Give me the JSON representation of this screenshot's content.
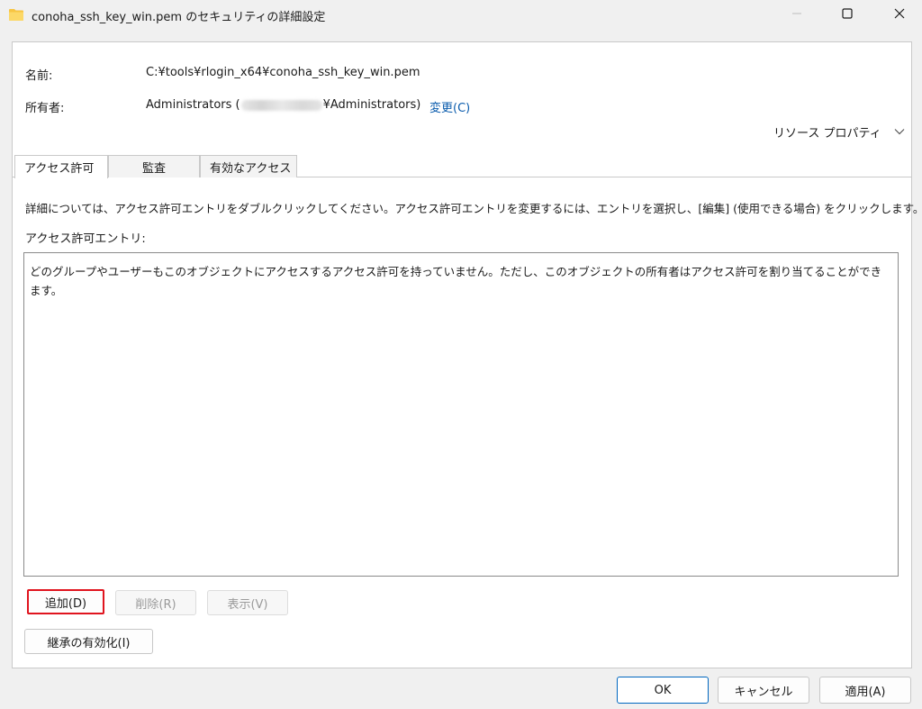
{
  "window": {
    "title": "conoha_ssh_key_win.pem のセキュリティの詳細設定"
  },
  "details": {
    "name_label": "名前:",
    "name_value": "C:¥tools¥rlogin_x64¥conoha_ssh_key_win.pem",
    "owner_label": "所有者:",
    "owner_prefix": "Administrators (",
    "owner_suffix": "¥Administrators)",
    "change_link": "変更(C)",
    "resource_properties": "リソース プロパティ"
  },
  "tabs": [
    {
      "label": "アクセス許可",
      "active": true
    },
    {
      "label": "監査",
      "active": false
    },
    {
      "label": "有効なアクセス",
      "active": false
    }
  ],
  "permissions": {
    "info_text": "詳細については、アクセス許可エントリをダブルクリックしてください。アクセス許可エントリを変更するには、エントリを選択し、[編集] (使用できる場合) をクリックします。",
    "entries_label": "アクセス許可エントリ:",
    "empty_message": "どのグループやユーザーもこのオブジェクトにアクセスするアクセス許可を持っていません。ただし、このオブジェクトの所有者はアクセス許可を割り当てることができます。",
    "add_button": "追加(D)",
    "remove_button": "削除(R)",
    "view_button": "表示(V)",
    "inherit_button": "継承の有効化(I)"
  },
  "footer": {
    "ok": "OK",
    "cancel": "キャンセル",
    "apply": "適用(A)"
  },
  "colors": {
    "link": "#0b5cad",
    "highlight_border": "#e0141e",
    "ok_border": "#0067c0"
  }
}
